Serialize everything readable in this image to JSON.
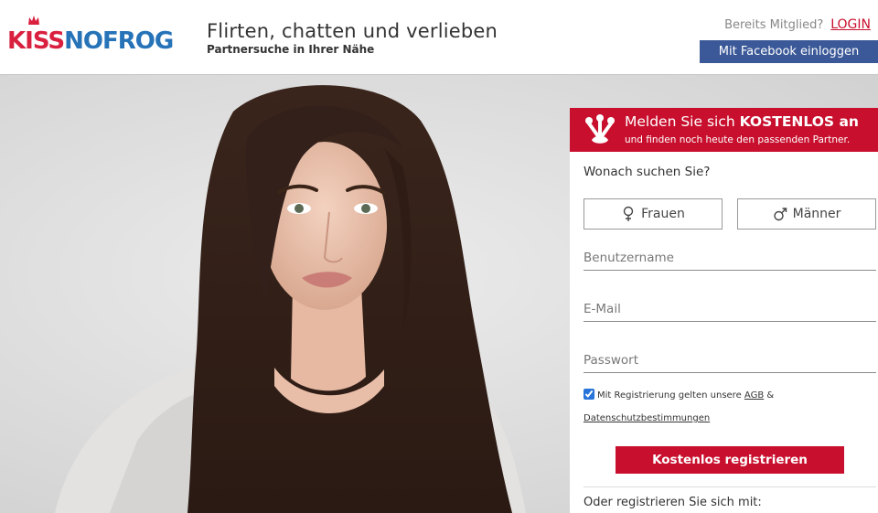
{
  "header": {
    "logo_kiss": "KISS",
    "logo_nofrog": "NOFROG",
    "title": "Flirten, chatten und verlieben",
    "subtitle": "Partnersuche in Ihrer Nähe",
    "member_text": "Bereits Mitglied?",
    "login_label": "LOGIN",
    "facebook_label": "Mit Facebook einloggen"
  },
  "register": {
    "headline_prefix": "Melden Sie sich ",
    "headline_bold": "KOSTENLOS an",
    "headline_sub": "und finden noch heute den passenden Partner.",
    "question": "Wonach suchen Sie?",
    "gender_female": "Frauen",
    "gender_male": "Männer",
    "username_placeholder": "Benutzername",
    "email_placeholder": "E-Mail",
    "password_placeholder": "Passwort",
    "terms_prefix": "Mit Registrierung gelten unsere",
    "terms_link": "AGB",
    "terms_amp": "&",
    "privacy_link": "Datenschutzbestimmungen",
    "terms_checked": true,
    "submit_label": "Kostenlos registrieren",
    "alt_register": "Oder registrieren Sie sich mit:"
  },
  "colors": {
    "brand_red": "#c8102e",
    "brand_blue": "#2673b8",
    "facebook_blue": "#3b5998"
  },
  "icons": {
    "logo": "crown-logo-icon",
    "panel": "frog-foot-icon",
    "female": "female-symbol-icon",
    "male": "male-symbol-icon"
  }
}
